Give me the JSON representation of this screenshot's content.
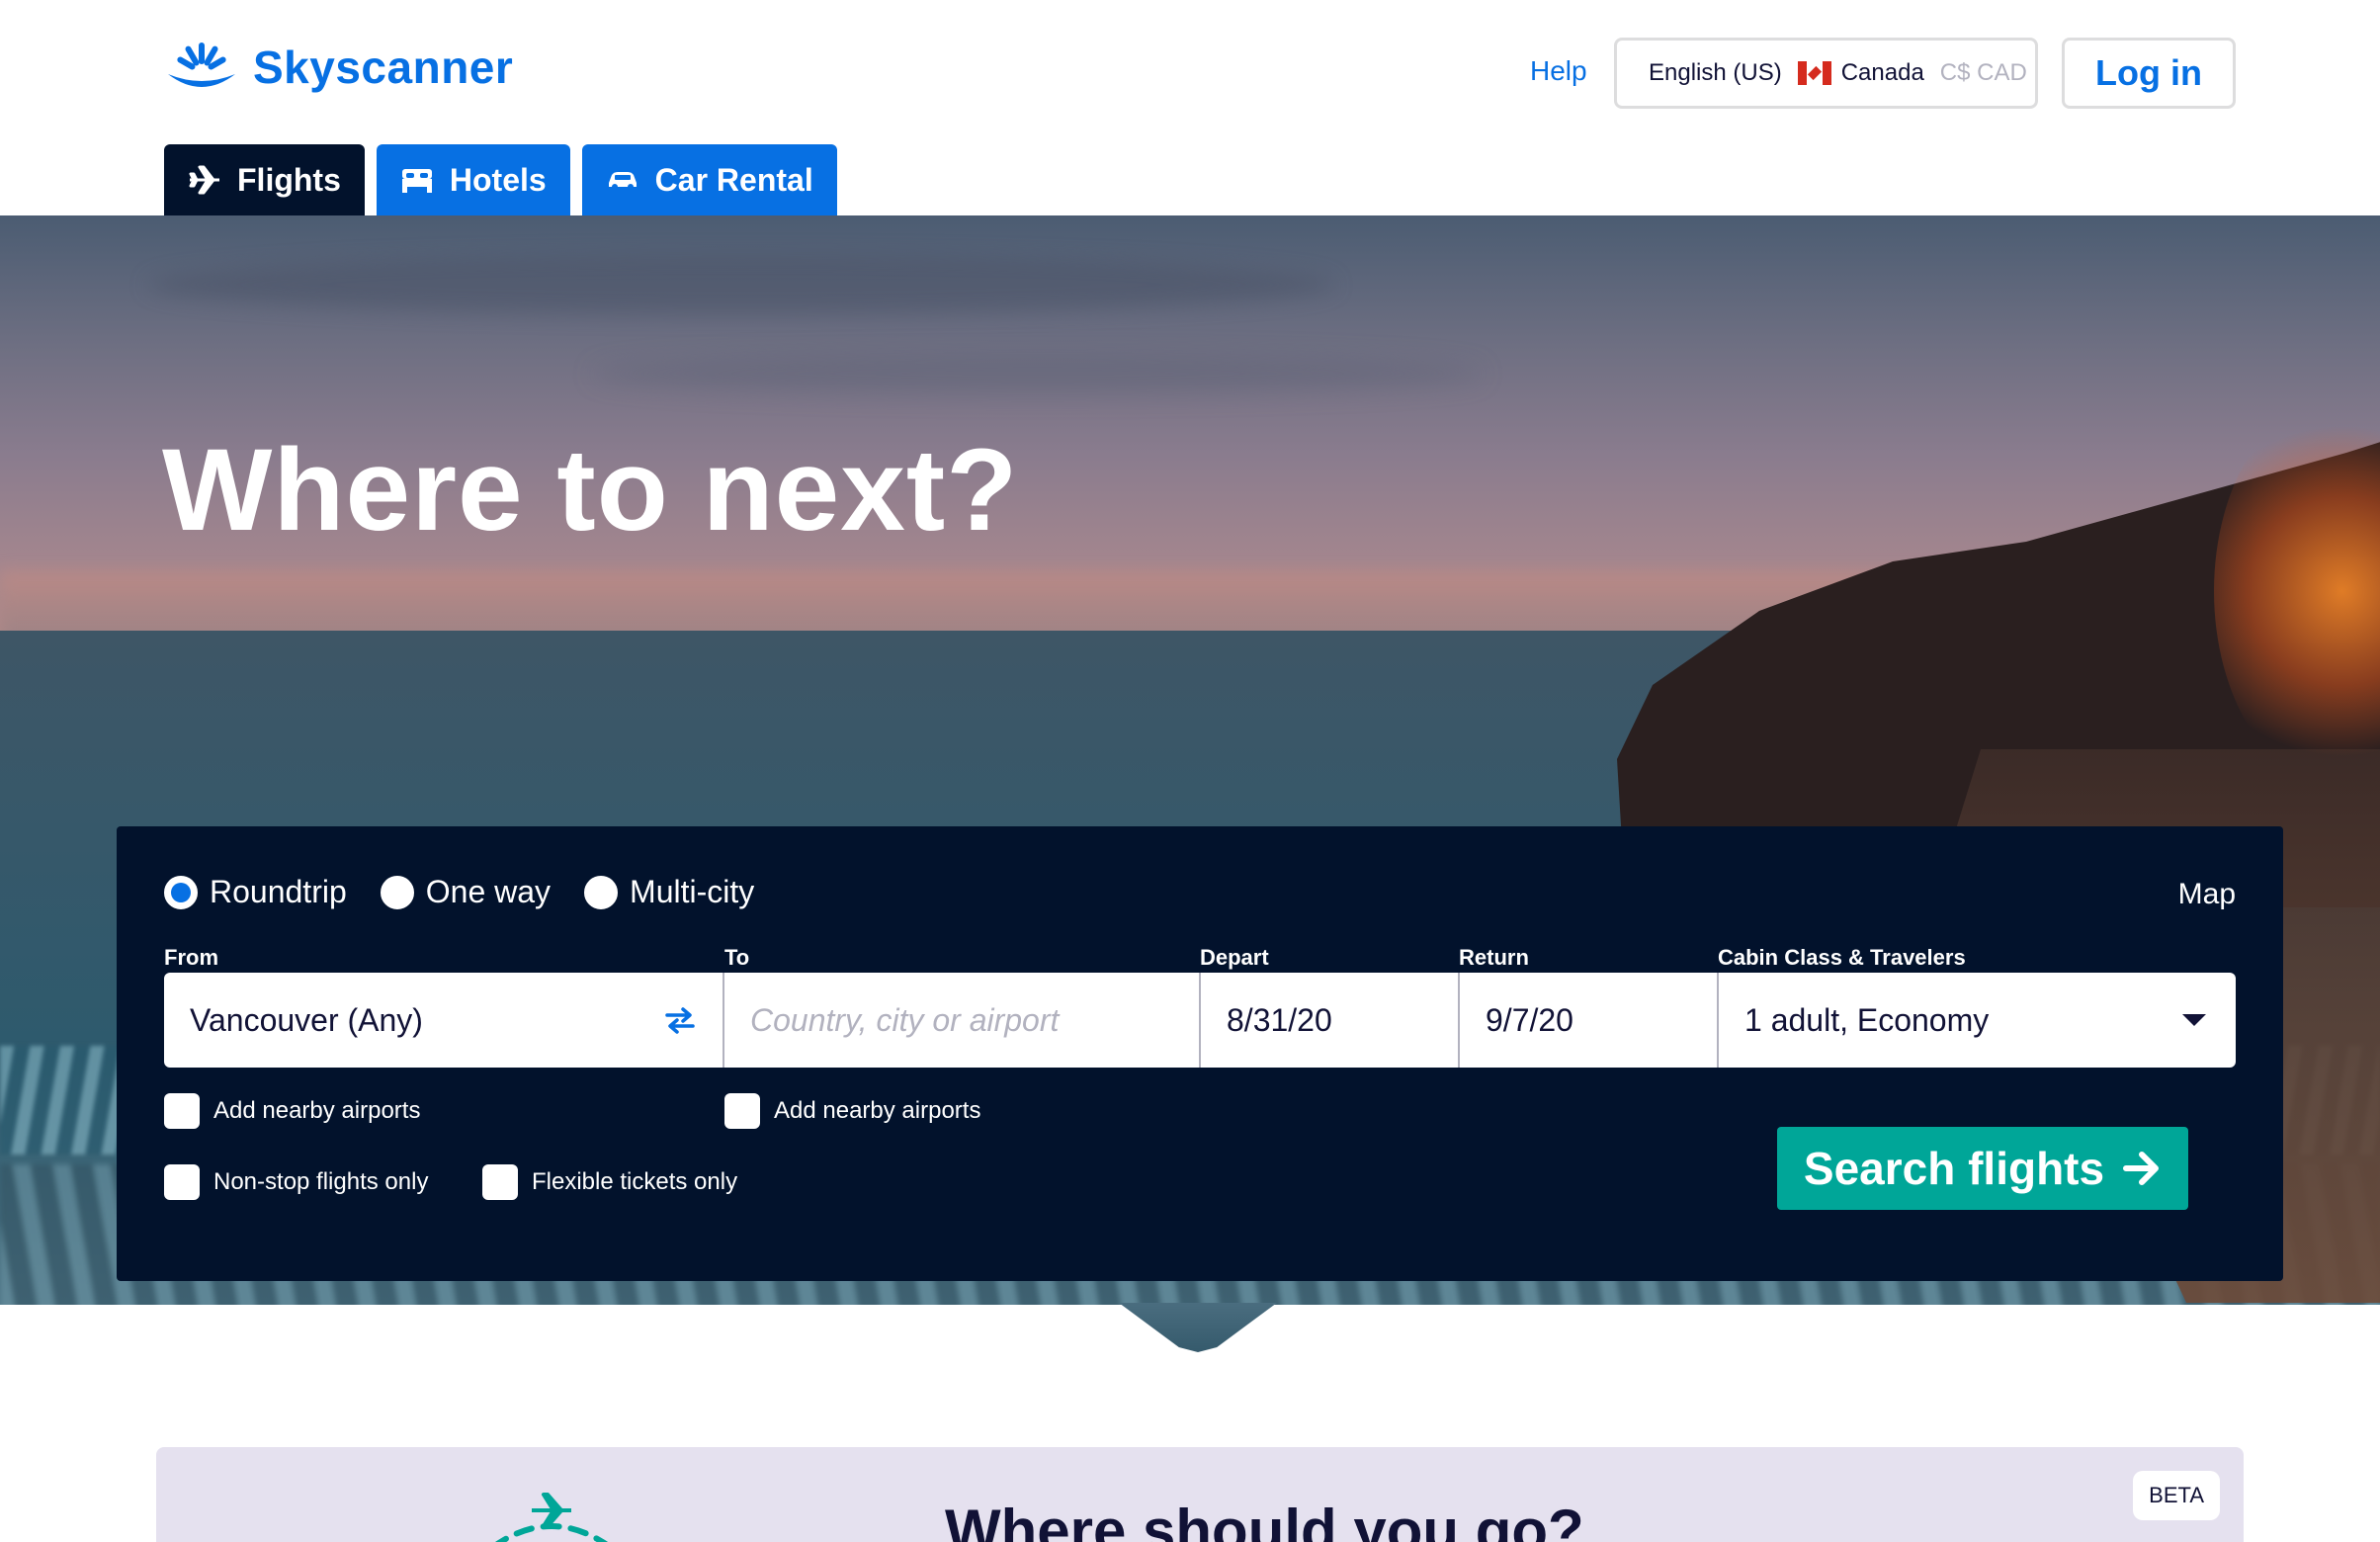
{
  "header": {
    "brand": "Skyscanner",
    "help_label": "Help",
    "locale": {
      "language": "English (US)",
      "country": "Canada",
      "currency": "C$ CAD"
    },
    "login_label": "Log in"
  },
  "tabs": [
    {
      "label": "Flights",
      "icon": "plane-icon",
      "active": true
    },
    {
      "label": "Hotels",
      "icon": "bed-icon",
      "active": false
    },
    {
      "label": "Car Rental",
      "icon": "car-icon",
      "active": false
    }
  ],
  "hero": {
    "title": "Where to next?"
  },
  "search": {
    "trip_types": [
      {
        "label": "Roundtrip",
        "checked": true
      },
      {
        "label": "One way",
        "checked": false
      },
      {
        "label": "Multi-city",
        "checked": false
      }
    ],
    "map_label": "Map",
    "labels": {
      "from": "From",
      "to": "To",
      "depart": "Depart",
      "return": "Return",
      "cabin": "Cabin Class & Travelers"
    },
    "from_value": "Vancouver (Any)",
    "to_placeholder": "Country, city or airport",
    "depart_value": "8/31/20",
    "return_value": "9/7/20",
    "cabin_value": "1 adult, Economy",
    "checkboxes": {
      "from_nearby": "Add nearby airports",
      "to_nearby": "Add nearby airports",
      "nonstop": "Non-stop flights only",
      "flexible": "Flexible tickets only"
    },
    "submit_label": "Search flights"
  },
  "inspire": {
    "title": "Where should you go?",
    "badge": "BETA"
  },
  "colors": {
    "brand_blue": "#0770e3",
    "navy": "#02122c",
    "teal": "#00a698"
  }
}
